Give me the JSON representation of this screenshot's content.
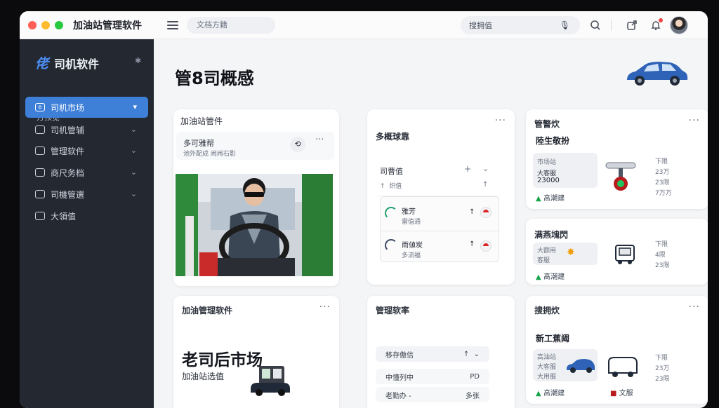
{
  "titlebar": {
    "app_title": "加油站管理软件",
    "search_placeholder": "文档方籍",
    "right_search_placeholder": "搜拥值",
    "icons": [
      "menu-icon",
      "microphone-icon",
      "search-icon",
      "share-icon",
      "bell-icon",
      "avatar"
    ]
  },
  "sidebar": {
    "brand_logo": "佬",
    "brand_name": "司机软件",
    "section_label": "方预览",
    "items": [
      {
        "label": "司机市场",
        "icon": "e",
        "active": true
      },
      {
        "label": "司机管辅",
        "icon": "",
        "active": false
      },
      {
        "label": "管理软件",
        "icon": "",
        "active": false
      },
      {
        "label": "商尺务档",
        "icon": "",
        "active": false
      },
      {
        "label": "司機管選",
        "icon": "",
        "active": false
      },
      {
        "label": "大領值",
        "icon": "",
        "active": false
      }
    ]
  },
  "main": {
    "page_title": "管8司概感",
    "card_video": {
      "title": "加油站管件",
      "sub": "多可雅帮",
      "caption": "池外配成 闹闹石影"
    },
    "card_list": {
      "title": "多概球靠",
      "row1": {
        "label": "司曹值",
        "sub": "炽值"
      },
      "item1": {
        "name": "雅芳",
        "sub": "雷值通"
      },
      "item2": {
        "name": "雨値炭",
        "sub": "多流福"
      }
    },
    "card_stats1": {
      "title": "管警炊",
      "sub": "陸生敬扮",
      "box_lines": [
        "市场站",
        "大客服",
        "23000"
      ],
      "side_lines": [
        "下限",
        "23万",
        "23限",
        "7万万"
      ],
      "tag": "高潮建"
    },
    "card_stats2": {
      "title": "满燕塊閃",
      "box_lines": [
        "大额用",
        "客服"
      ],
      "side_lines": [
        "下限",
        "4限",
        "23限"
      ],
      "tag": "高潮建"
    },
    "card_market": {
      "title": "加油管理软件",
      "big": "老司后市场",
      "sub": "加油站选值"
    },
    "card_soft": {
      "title": "管理软率",
      "row1": "移存傲信",
      "row2_left": "中懂列中",
      "row2_right": "PD",
      "row3_left": "老勤办 -",
      "row3_right": "多张"
    },
    "card_stats3": {
      "title": "搜拥炊",
      "sub": "新工蕉阈",
      "box_lines": [
        "高油站",
        "大客服",
        "大用服"
      ],
      "side_lines": [
        "下限",
        "23万",
        "23限"
      ],
      "tag": "高潮建",
      "tag2": "文服"
    }
  },
  "colors": {
    "sidebar_bg": "#232831",
    "active_item": "#3e7fd8",
    "accent_green": "#16a34a",
    "brand_blue": "#4c8cf0"
  }
}
